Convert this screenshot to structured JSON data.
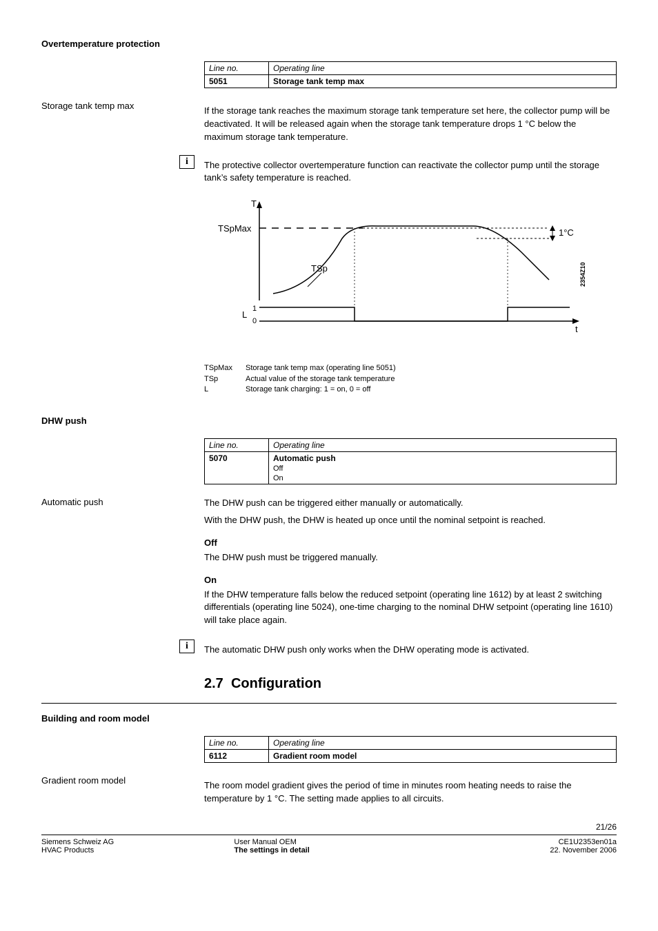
{
  "section1_title": "Overtemperature protection",
  "tbl1": {
    "hdr_line": "Line no.",
    "hdr_op": "Operating line",
    "num": "5051",
    "name": "Storage tank temp max"
  },
  "side1": "Storage tank temp max",
  "para1": "If the storage tank reaches the maximum storage tank temperature set here, the collector pump will be deactivated. It will be released again when the storage tank temperature drops 1 °C below the maximum storage tank temperature.",
  "para2": "The protective collector overtemperature function can reactivate the collector pump until the storage tank’s safety temperature is reached.",
  "chart_data": {
    "type": "line",
    "title": "",
    "xlabel": "t",
    "ylabel": "T",
    "left_axis_labels": [
      "TSpMax",
      "TSp"
    ],
    "hysteresis_label": "1°C",
    "digital_axis": {
      "label": "L",
      "ticks": [
        0,
        1
      ]
    },
    "ref_code": "2354Z10",
    "description": "Storage tank temperature curve crossing TSpMax with 1°C hysteresis band and corresponding on/off digital output L"
  },
  "legend": [
    {
      "k": "TSpMax",
      "v": "Storage tank temp max (operating line 5051)"
    },
    {
      "k": "TSp",
      "v": "Actual value of the storage tank temperature"
    },
    {
      "k": "L",
      "v": "Storage tank charging: 1 = on, 0 = off"
    }
  ],
  "section2_title": "DHW push",
  "tbl2": {
    "hdr_line": "Line no.",
    "hdr_op": "Operating line",
    "num": "5070",
    "name": "Automatic push",
    "opts": [
      "Off",
      "On"
    ]
  },
  "side2": "Automatic push",
  "para3a": "The DHW push can be triggered either manually or automatically.",
  "para3b": "With the DHW push, the DHW is heated up once until the nominal setpoint is reached.",
  "off_h": "Off",
  "off_t": "The DHW push must be triggered manually.",
  "on_h": "On",
  "on_t": "If the DHW temperature falls below the reduced setpoint (operating line 1612) by at least 2 switching differentials (operating line 5024), one-time charging to the nominal DHW setpoint (operating line 1610) will take place again.",
  "para4": "The automatic DHW push only works when the DHW operating mode is activated.",
  "h2_num": "2.7",
  "h2_txt": "Configuration",
  "section3_title": "Building and room model",
  "tbl3": {
    "hdr_line": "Line no.",
    "hdr_op": "Operating line",
    "num": "6112",
    "name": "Gradient room model"
  },
  "side3": "Gradient room model",
  "para5": "The room model gradient gives the period of time in minutes room heating needs to raise the temperature by 1 °C. The setting made applies to all circuits.",
  "page_no": "21/26",
  "footer": {
    "l1": "Siemens Schweiz AG",
    "l2": "HVAC Products",
    "c1": "User Manual OEM",
    "c2": "The settings in detail",
    "r1": "CE1U2353en01a",
    "r2": "22. November 2006"
  }
}
